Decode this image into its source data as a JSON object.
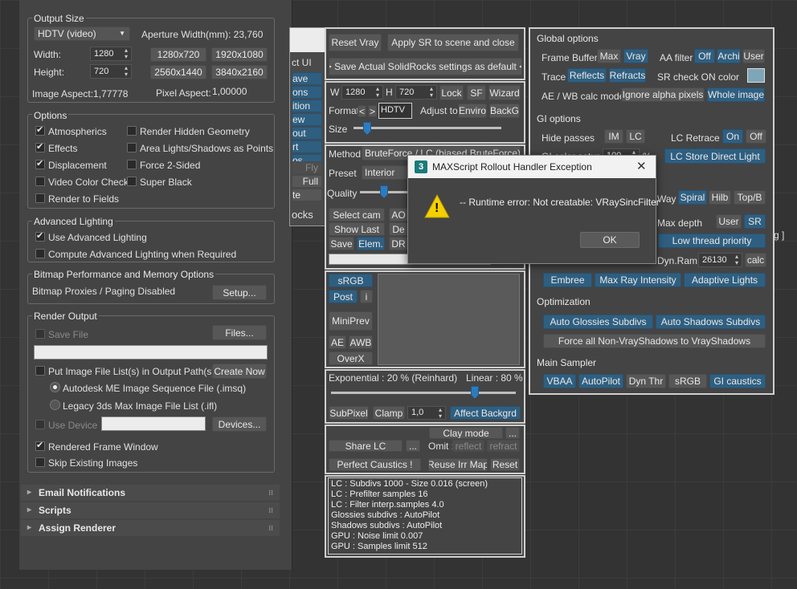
{
  "left_panel": {
    "output_size": {
      "title": "Output Size",
      "preset": "HDTV (video)",
      "aperture_label": "Aperture Width(mm): 23,760",
      "width_label": "Width:",
      "width": "1280",
      "height_label": "Height:",
      "height": "720",
      "presets": [
        "1280x720",
        "1920x1080",
        "2560x1440",
        "3840x2160"
      ],
      "image_aspect": "Image Aspect:1,77778",
      "pixel_aspect_label": "Pixel Aspect:",
      "pixel_aspect": "1,00000"
    },
    "options": {
      "title": "Options",
      "atmospherics": "Atmospherics",
      "render_hidden": "Render Hidden Geometry",
      "effects": "Effects",
      "area_lights": "Area Lights/Shadows as Points",
      "displacement": "Displacement",
      "force_2sided": "Force 2-Sided",
      "video_color": "Video Color Check",
      "super_black": "Super Black",
      "render_fields": "Render to Fields"
    },
    "advanced_lighting": {
      "title": "Advanced Lighting",
      "use": "Use Advanced Lighting",
      "compute": "Compute Advanced Lighting when Required"
    },
    "bitmap": {
      "title": "Bitmap Performance and Memory Options",
      "status": "Bitmap Proxies / Paging Disabled",
      "setup": "Setup..."
    },
    "render_output": {
      "title": "Render Output",
      "save_file": "Save File",
      "files": "Files...",
      "put_image": "Put Image File List(s) in Output Path(s)",
      "create_now": "Create Now",
      "autodesk": "Autodesk ME Image Sequence File (.imsq)",
      "legacy": "Legacy 3ds Max Image File List (.ifl)",
      "use_device": "Use Device",
      "devices": "Devices...",
      "rendered_frame": "Rendered Frame Window",
      "skip_existing": "Skip Existing Images"
    },
    "rollouts": [
      "Email Notifications",
      "Scripts",
      "Assign Renderer"
    ]
  },
  "back_window": {
    "items": [
      "ct UI",
      "ave",
      "ons",
      "ition",
      "ew",
      "out",
      "rt",
      "os",
      "Fly",
      "Full",
      "te",
      "ocks"
    ]
  },
  "center_panel": {
    "reset_vray": "Reset Vray",
    "apply_sr": "Apply SR to scene and close",
    "save_actual": ">> Save Actual SolidRocks settings as default <<",
    "w_label": "W",
    "w_value": "1280",
    "h_label": "H",
    "h_value": "720",
    "lock": "Lock",
    "sf": "SF",
    "wizard": "Wizard",
    "format_label": "Format",
    "format_prev": "<",
    "format_next": ">",
    "format_value": "HDTV",
    "adjust_label": "Adjust to",
    "enviro": "Enviro",
    "backg": "BackG",
    "size_label": "Size",
    "method_label": "Method",
    "method_value": "BruteForce / LC (biased BruteForce)",
    "preset_label": "Preset",
    "preset_value": "Interior",
    "quality_label": "Quality",
    "select_cam": "Select cam",
    "ao": "AO",
    "show_last": "Show Last",
    "de": "De",
    "save": "Save",
    "elem": "Elem.",
    "dr": "DR",
    "srgb": "sRGB",
    "post": "Post",
    "i": "i",
    "miniprev": "MiniPrev",
    "ae": "AE",
    "awb": "AWB",
    "overx": "OverX",
    "exponential": "Exponential : 20 %  (Reinhard)",
    "linear": "Linear : 80 %",
    "subpixel": "SubPixel",
    "clamp": "Clamp",
    "clamp_value": "1,0",
    "affect_backgrd": "Affect Backgrd",
    "clay_mode": "Clay mode",
    "dots": "...",
    "share_lc": "Share LC",
    "omit_label": "Omit :",
    "reflect": "reflect",
    "refract": "refract",
    "perfect_caustics": "Perfect Caustics !",
    "reuse_irr": "Reuse Irr Map",
    "reset": "Reset",
    "info": [
      "LC : Subdivs 1000 - Size 0.016 (screen)",
      "LC : Prefilter samples 16",
      "LC : Filter interp.samples  4.0",
      "Glossies subdivs : AutoPilot",
      "Shadows subdivs : AutoPilot",
      "GPU : Noise limit 0.007",
      "GPU : Samples limit 512"
    ]
  },
  "right_panel": {
    "global_options": "Global options",
    "frame_buffer": "Frame Buffer",
    "max": "Max",
    "vray": "Vray",
    "aa_filter": "AA filter",
    "off": "Off",
    "archi": "Archi",
    "user": "User",
    "trace": "Trace",
    "reflects": "Reflects",
    "refracts": "Refracts",
    "sr_check": "SR check ON color",
    "sr_color": "#7ea6b8",
    "ae_wb": "AE / WB calc mode",
    "ignore_alpha": "Ignore alpha pixels",
    "whole_image": "Whole image",
    "gi_options": "GI options",
    "hide_passes": "Hide passes",
    "im": "IM",
    "lc": "LC",
    "lc_retrace": "LC Retrace",
    "on": "On",
    "lc_off": "Off",
    "gi_color_satur": "GI color satur.",
    "gi_color_value": "100",
    "pct": "%",
    "lc_store": "LC Store Direct Light",
    "way": "Way",
    "spiral": "Spiral",
    "hilb": "Hilb",
    "topb": "Top/B",
    "max_depth": "Max depth",
    "md_user": "User",
    "sr": "SR",
    "low_thread": "Low thread priority",
    "dyn_ram": "Dyn.Ram",
    "dyn_ram_value": "26130",
    "calc": "calc",
    "embree": "Embree",
    "max_ray": "Max Ray Intensity",
    "adaptive_lights": "Adaptive Lights",
    "optimization": "Optimization",
    "auto_glossies": "Auto Glossies Subdivs",
    "auto_shadows": "Auto Shadows Subdivs",
    "force_all": "Force all Non-VrayShadows to VrayShadows",
    "main_sampler": "Main Sampler",
    "vbaa": "VBAA",
    "autopilot": "AutoPilot",
    "dyn_thr": "Dyn Thr",
    "srgb": "sRGB",
    "gi_caustics": "GI caustics"
  },
  "dialog": {
    "title": "MAXScript Rollout Handler Exception",
    "app_icon": "3",
    "close": "✕",
    "message": "-- Runtime error: Not creatable: VRaySincFilter",
    "ok": "OK",
    "warning_icon": "!"
  },
  "viewport_fragment": "g ]"
}
